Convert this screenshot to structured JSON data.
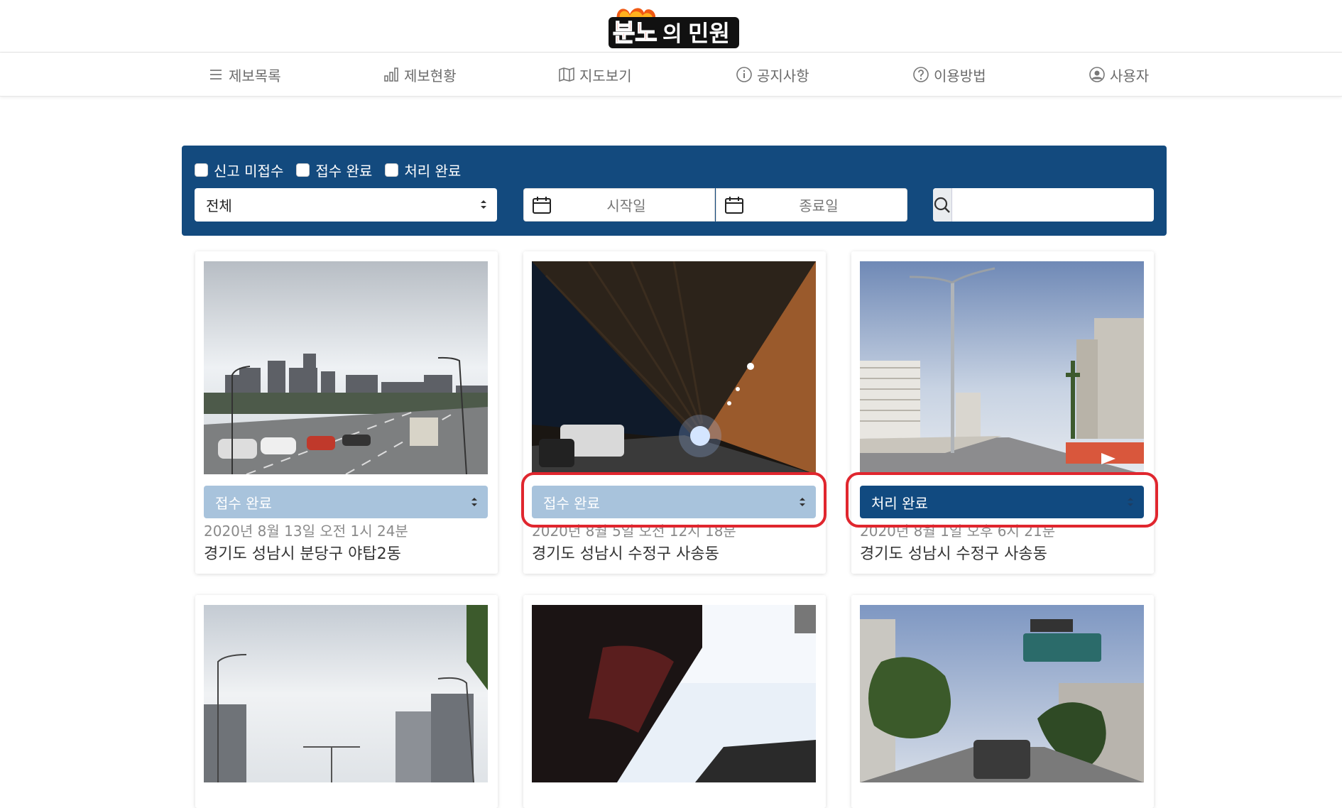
{
  "header": {
    "logo_text": "분노의 민원"
  },
  "nav": {
    "items": [
      {
        "label": "제보목록",
        "icon": "list-icon"
      },
      {
        "label": "제보현황",
        "icon": "bar-chart-icon"
      },
      {
        "label": "지도보기",
        "icon": "map-icon"
      },
      {
        "label": "공지사항",
        "icon": "info-icon"
      },
      {
        "label": "이용방법",
        "icon": "question-icon"
      },
      {
        "label": "사용자",
        "icon": "user-icon"
      }
    ]
  },
  "filter": {
    "checkboxes": [
      "신고 미접수",
      "접수 완료",
      "처리 완료"
    ],
    "region_select": "전체",
    "start_date_placeholder": "시작일",
    "end_date_placeholder": "종료일",
    "search_value": ""
  },
  "cards": [
    {
      "status": "접수 완료",
      "date": "2020년 8월 13일  오전 1시 24분",
      "address": "경기도 성남시 분당구 야탑2동"
    },
    {
      "status": "접수 완료",
      "date": "2020년 8월 5일  오전 12시 18분",
      "address": "경기도 성남시 수정구 사송동"
    },
    {
      "status": "처리 완료",
      "date": "2020년 8월 1일  오후 6시 21분",
      "address": "경기도 성남시 수정구 사송동"
    },
    {
      "status": "",
      "date": "",
      "address": ""
    },
    {
      "status": "",
      "date": "",
      "address": ""
    },
    {
      "status": "",
      "date": "",
      "address": ""
    }
  ],
  "colors": {
    "panel": "#134a7e",
    "status_light": "#a8c3dc",
    "status_dark": "#114a80",
    "highlight": "#e0262e"
  }
}
